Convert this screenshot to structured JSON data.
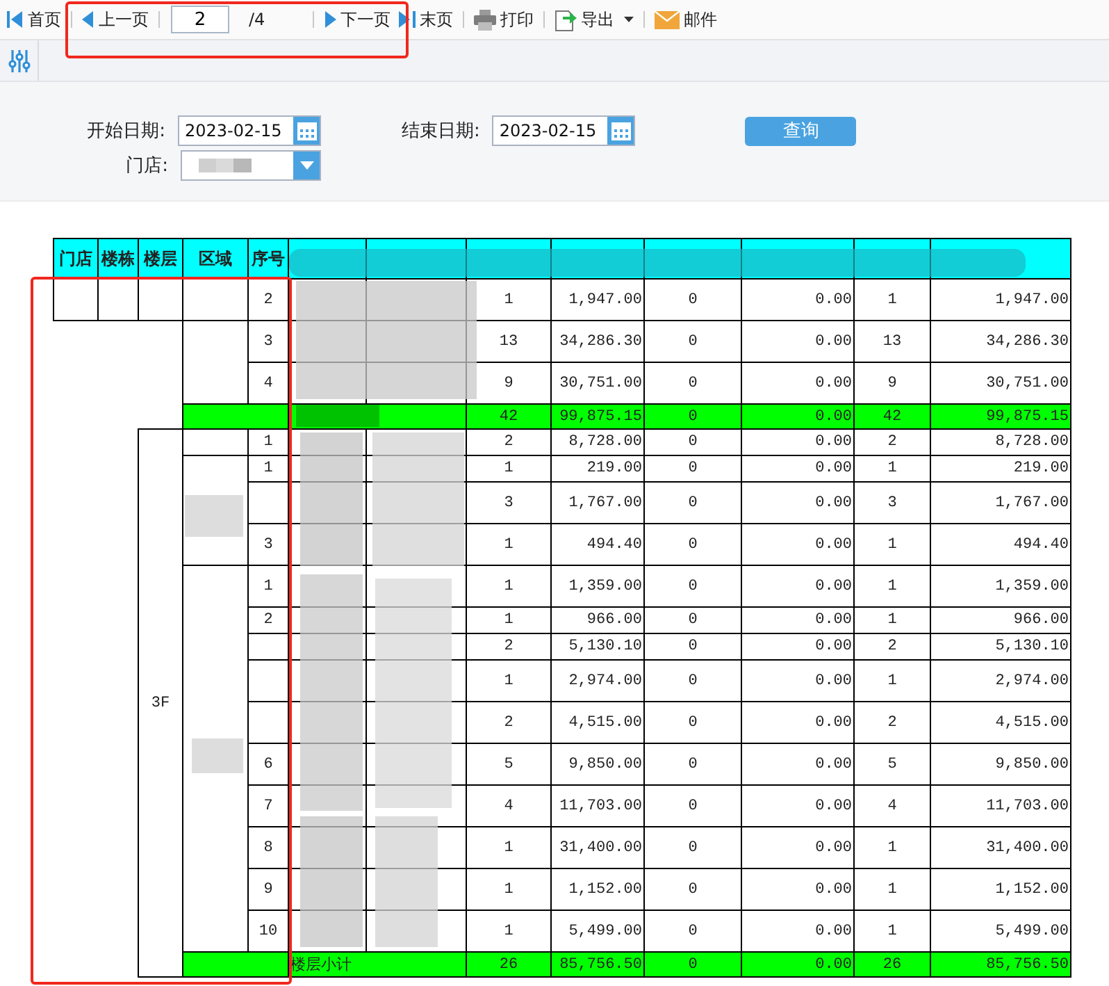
{
  "toolbar": {
    "items": [
      {
        "kind": "first",
        "label": "首页"
      },
      {
        "kind": "prev",
        "label": "上一页"
      },
      {
        "kind": "page",
        "value": "2",
        "total": "/4"
      },
      {
        "kind": "next",
        "label": "下一页"
      },
      {
        "kind": "last",
        "label": "末页"
      },
      {
        "kind": "print",
        "label": "打印"
      },
      {
        "kind": "export",
        "label": "导出"
      },
      {
        "kind": "mail",
        "label": "邮件"
      }
    ]
  },
  "filters": {
    "start": {
      "label": "开始日期:",
      "value": "2023-02-15"
    },
    "end": {
      "label": "结束日期:",
      "value": "2023-02-15"
    },
    "store": {
      "label": "门店:"
    },
    "query_button": "查询"
  },
  "table": {
    "columns": [
      "门店",
      "楼栋",
      "楼层",
      "区域",
      "序号"
    ],
    "blocks": [
      {
        "kind": "lead",
        "rows": [
          {
            "seq": "2",
            "wrapped": true,
            "values": [
              "1",
              "1,947.00",
              "0",
              "0.00",
              "1",
              "1,947.00"
            ]
          }
        ]
      },
      {
        "kind": "floor",
        "areas": [
          {
            "rows": [
              {
                "seq": "3",
                "wrapped": true,
                "values": [
                  "13",
                  "34,286.30",
                  "0",
                  "0.00",
                  "13",
                  "34,286.30"
                ]
              },
              {
                "seq": "4",
                "wrapped": true,
                "values": [
                  "9",
                  "30,751.00",
                  "0",
                  "0.00",
                  "9",
                  "30,751.00"
                ]
              }
            ]
          }
        ],
        "subtotal": {
          "values": [
            "42",
            "99,875.15",
            "0",
            "0.00",
            "42",
            "99,875.15"
          ]
        }
      },
      {
        "kind": "floor",
        "floor": "3F",
        "areas": [
          {
            "rows": [
              {
                "seq": "1",
                "wrapped": false,
                "values": [
                  "2",
                  "8,728.00",
                  "0",
                  "0.00",
                  "2",
                  "8,728.00"
                ]
              }
            ]
          },
          {
            "rows": [
              {
                "seq": "1",
                "wrapped": false,
                "values": [
                  "1",
                  "219.00",
                  "0",
                  "0.00",
                  "1",
                  "219.00"
                ]
              },
              {
                "wrapped": true,
                "values": [
                  "3",
                  "1,767.00",
                  "0",
                  "0.00",
                  "3",
                  "1,767.00"
                ]
              },
              {
                "seq": "3",
                "wrapped": true,
                "values": [
                  "1",
                  "494.40",
                  "0",
                  "0.00",
                  "1",
                  "494.40"
                ]
              }
            ]
          },
          {
            "rows": [
              {
                "seq": "1",
                "wrapped": true,
                "values": [
                  "1",
                  "1,359.00",
                  "0",
                  "0.00",
                  "1",
                  "1,359.00"
                ]
              },
              {
                "seq": "2",
                "wrapped": false,
                "values": [
                  "1",
                  "966.00",
                  "0",
                  "0.00",
                  "1",
                  "966.00"
                ]
              },
              {
                "wrapped": false,
                "values": [
                  "2",
                  "5,130.10",
                  "0",
                  "0.00",
                  "2",
                  "5,130.10"
                ]
              },
              {
                "wrapped": true,
                "values": [
                  "1",
                  "2,974.00",
                  "0",
                  "0.00",
                  "1",
                  "2,974.00"
                ]
              },
              {
                "wrapped": true,
                "values": [
                  "2",
                  "4,515.00",
                  "0",
                  "0.00",
                  "2",
                  "4,515.00"
                ]
              },
              {
                "seq": "6",
                "wrapped": true,
                "values": [
                  "5",
                  "9,850.00",
                  "0",
                  "0.00",
                  "5",
                  "9,850.00"
                ]
              },
              {
                "seq": "7",
                "wrapped": true,
                "values": [
                  "4",
                  "11,703.00",
                  "0",
                  "0.00",
                  "4",
                  "11,703.00"
                ]
              },
              {
                "seq": "8",
                "wrapped": true,
                "values": [
                  "1",
                  "31,400.00",
                  "0",
                  "0.00",
                  "1",
                  "31,400.00"
                ]
              },
              {
                "seq": "9",
                "wrapped": true,
                "values": [
                  "1",
                  "1,152.00",
                  "0",
                  "0.00",
                  "1",
                  "1,152.00"
                ]
              },
              {
                "seq": "10",
                "wrapped": true,
                "values": [
                  "1",
                  "5,499.00",
                  "0",
                  "0.00",
                  "1",
                  "5,499.00"
                ]
              }
            ]
          }
        ],
        "subtotal": {
          "label": "楼层小计",
          "values": [
            "26",
            "85,756.50",
            "0",
            "0.00",
            "26",
            "85,756.50"
          ]
        }
      }
    ]
  }
}
